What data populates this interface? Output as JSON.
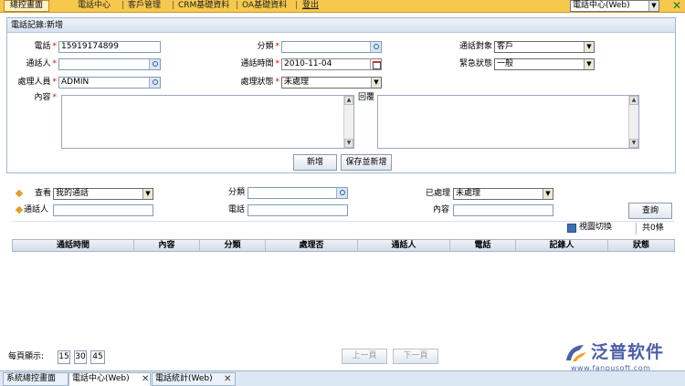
{
  "topnav": {
    "items": [
      "總控畫面",
      "電話中心",
      "客戶管理",
      "CRM基礎資料",
      "OA基礎資料",
      "登出"
    ],
    "module_select": "電話中心(Web)"
  },
  "form": {
    "title": "電話記錄:新增",
    "phone_label": "電話",
    "phone_value": "15919174899",
    "category_label": "分類",
    "call_target_label": "通話對象",
    "call_target_value": "客戶",
    "caller_label": "通話人",
    "call_time_label": "通話時間",
    "call_time_value": "2010-11-04",
    "urgency_label": "緊急狀態",
    "urgency_value": "一般",
    "handler_label": "處理人員",
    "handler_value": "ADMIN",
    "status_label": "處理狀態",
    "status_value": "未處理",
    "content_label": "內容",
    "reply_label": "回覆",
    "add_button": "新增",
    "save_add_button": "保存並新增"
  },
  "search": {
    "view_label": "查看",
    "view_value": "我的通話",
    "category_label": "分類",
    "processed_label": "已處理",
    "processed_value": "未處理",
    "caller_label": "通話人",
    "phone_label": "電話",
    "content_label": "內容",
    "query_button": "查詢",
    "switch_view": "視圖切換",
    "total": "共0條"
  },
  "grid": {
    "columns": [
      "通話時間",
      "內容",
      "分類",
      "處理否",
      "通話人",
      "電話",
      "記錄人",
      "狀態"
    ]
  },
  "pager": {
    "per_page_label": "每頁顯示:",
    "options": [
      "15",
      "30",
      "45"
    ],
    "prev": "上一頁",
    "next": "下一頁"
  },
  "logo": {
    "brand": "泛普软件",
    "url": "www.fanpusoft.com"
  },
  "tabs": [
    "系統總控畫面",
    "電話中心(Web)",
    "電話統計(Web)"
  ],
  "colors": {
    "topbar": "#f6c84d",
    "required": "#e00000",
    "logo": "#4a5fa8"
  }
}
